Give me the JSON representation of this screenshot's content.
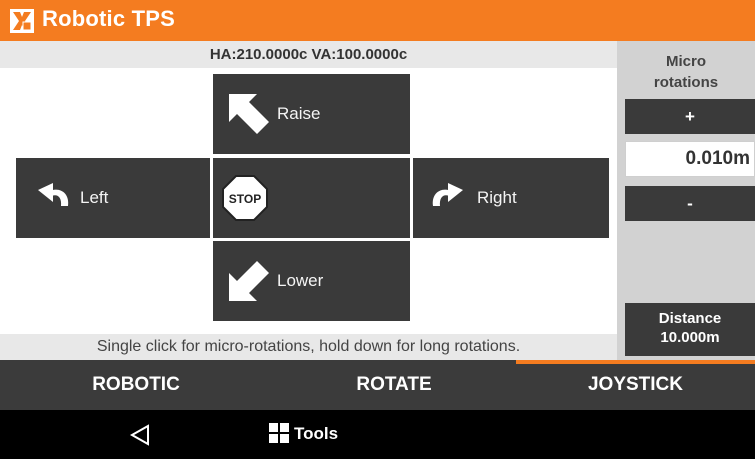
{
  "app": {
    "title": "Robotic TPS",
    "logo_icon": "tps-logo-icon",
    "accent_color": "#f47c20"
  },
  "angles": {
    "text": "HA:210.0000c  VA:100.0000c"
  },
  "joystick": {
    "raise_label": "Raise",
    "left_label": "Left",
    "stop_label": "STOP",
    "right_label": "Right",
    "lower_label": "Lower",
    "hint": "Single click for micro-rotations, hold down for long rotations."
  },
  "side_panel": {
    "micro_title_line1": "Micro",
    "micro_title_line2": "rotations",
    "plus_label": "+",
    "value": "0.010m",
    "minus_label": "-",
    "distance_label": "Distance",
    "distance_value": "10.000m"
  },
  "tabs": [
    {
      "label": "ROBOTIC",
      "active": false
    },
    {
      "label": "ROTATE",
      "active": false
    },
    {
      "label": "JOYSTICK",
      "active": true
    }
  ],
  "navbar": {
    "back_icon": "back-triangle-icon",
    "tools_label": "Tools",
    "tools_icon": "grid-icon"
  }
}
